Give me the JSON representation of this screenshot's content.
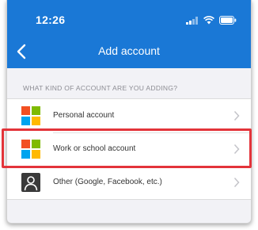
{
  "status_bar": {
    "time": "12:26"
  },
  "nav": {
    "title": "Add account",
    "back_icon": "chevron-left-icon"
  },
  "section": {
    "header": "WHAT KIND OF ACCOUNT ARE YOU ADDING?"
  },
  "accounts": [
    {
      "label": "Personal account",
      "icon": "microsoft-logo-icon"
    },
    {
      "label": "Work or school account",
      "icon": "microsoft-logo-icon"
    },
    {
      "label": "Other (Google, Facebook, etc.)",
      "icon": "person-icon"
    }
  ],
  "colors": {
    "accent": "#1a78d6",
    "highlight": "#e3343a",
    "ms_red": "#f25022",
    "ms_green": "#7fba00",
    "ms_blue": "#00a4ef",
    "ms_yellow": "#ffb900"
  }
}
